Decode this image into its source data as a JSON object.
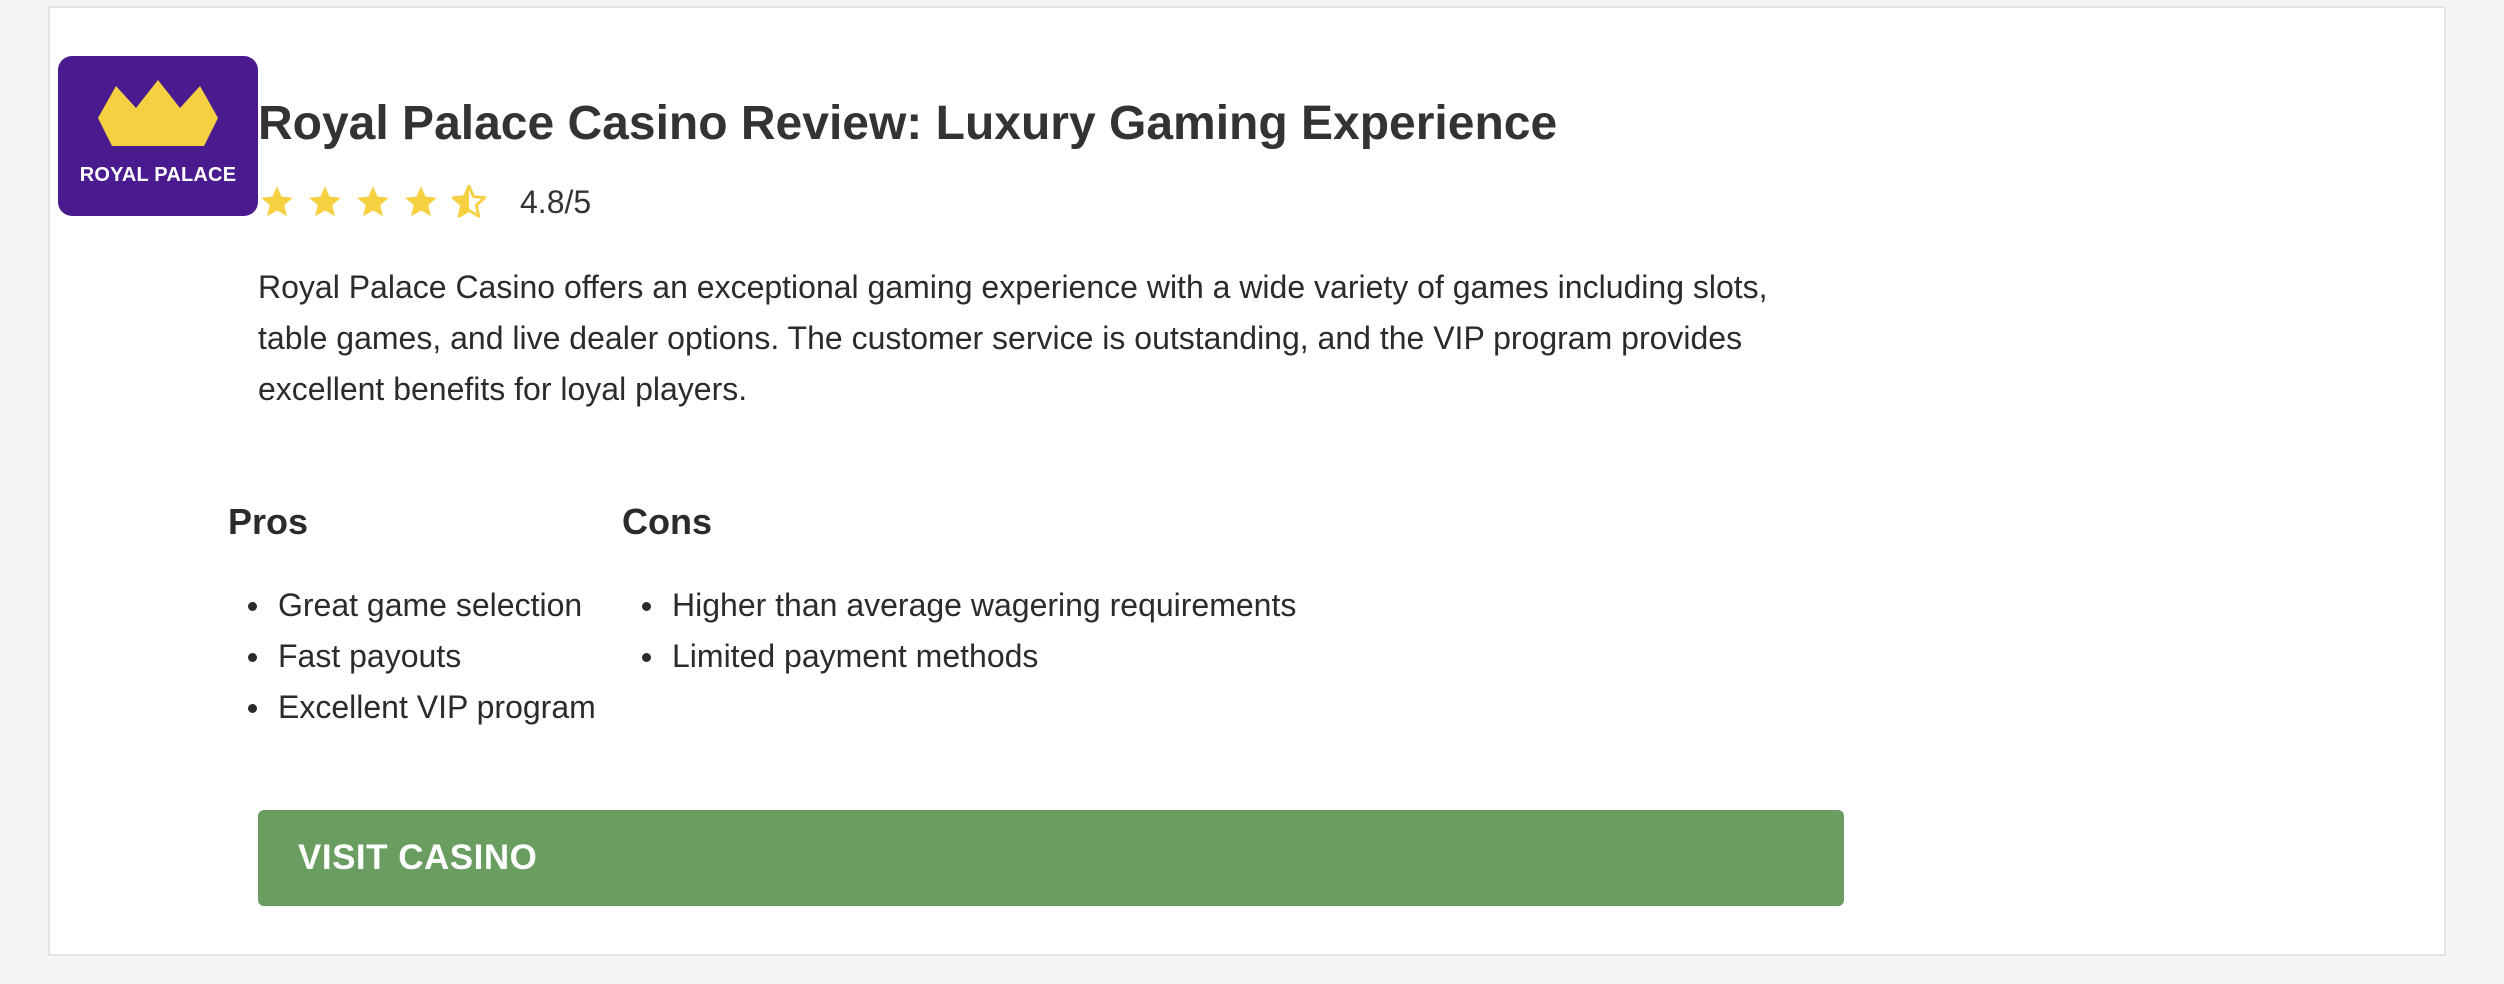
{
  "logo": {
    "text": "ROYAL PALACE",
    "background_color": "#4a1b8f",
    "crown_color": "#f5d142",
    "icon": "crown-icon"
  },
  "review": {
    "title": "Royal Palace Casino Review: Luxury Gaming Experience",
    "rating": 4.8,
    "rating_max": 5,
    "rating_text": "4.8/5",
    "star_color": "#f5d142",
    "description": "Royal Palace Casino offers an exceptional gaming experience with a wide variety of games including slots, table games, and live dealer options. The customer service is outstanding, and the VIP program provides excellent benefits for loyal players."
  },
  "pros": {
    "heading": "Pros",
    "items": [
      "Great game selection",
      "Fast payouts",
      "Excellent VIP program"
    ]
  },
  "cons": {
    "heading": "Cons",
    "items": [
      "Higher than average wagering requirements",
      "Limited payment methods"
    ]
  },
  "cta": {
    "label": "VISIT CASINO",
    "color": "#6a9e60"
  }
}
